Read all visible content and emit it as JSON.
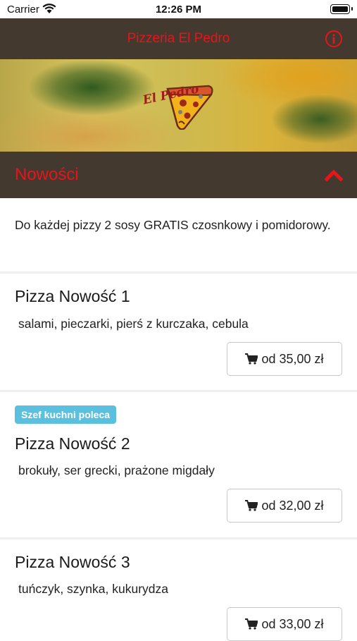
{
  "status_bar": {
    "carrier": "Carrier",
    "time": "12:26 PM"
  },
  "nav": {
    "title": "Pizzeria El Pedro"
  },
  "banner": {
    "logo_text": "El Pedro"
  },
  "section": {
    "title": "Nowości"
  },
  "notice": "Do każdej pizzy 2 sosy GRATIS czosnkowy i pomidorowy.",
  "items": [
    {
      "title": "Pizza Nowość 1",
      "description": "salami, pieczarki, pierś z kurczaka, cebula",
      "price": "od 35,00 zł"
    },
    {
      "badge": "Szef kuchni poleca",
      "title": "Pizza Nowość 2",
      "description": "brokuły, ser grecki, prażone migdały",
      "price": "od 32,00 zł"
    },
    {
      "title": "Pizza Nowość 3",
      "description": "tuńczyk, szynka, kukurydza",
      "price": "od 33,00 zł"
    }
  ],
  "colors": {
    "bar": "#44392e",
    "accent": "#e8141b",
    "badge": "#5bc0de"
  }
}
